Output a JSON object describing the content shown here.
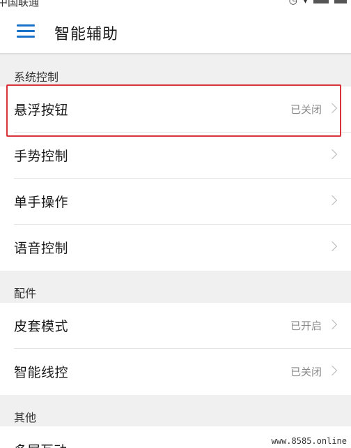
{
  "status_bar": {
    "carrier": "中国联通",
    "icons_right": [
      "alarm-icon",
      "wifi-icon",
      "signal-icon",
      "battery-icon"
    ]
  },
  "header": {
    "menu_icon": "hamburger-menu-icon",
    "title": "智能辅助"
  },
  "sections": [
    {
      "title": "系统控制",
      "items": [
        {
          "label": "悬浮按钮",
          "value": "已关闭"
        },
        {
          "label": "手势控制",
          "value": ""
        },
        {
          "label": "单手操作",
          "value": ""
        },
        {
          "label": "语音控制",
          "value": ""
        }
      ]
    },
    {
      "title": "配件",
      "items": [
        {
          "label": "皮套模式",
          "value": "已开启"
        },
        {
          "label": "智能线控",
          "value": "已关闭"
        }
      ]
    },
    {
      "title": "其他",
      "items": [
        {
          "label": "多屏互动",
          "value": ""
        }
      ]
    }
  ],
  "watermark": "www.8585.online",
  "colors": {
    "accent": "#1a73c8",
    "highlight": "#d9343b",
    "section_bg": "#f0f0f0",
    "secondary_text": "#8a8a8a"
  }
}
